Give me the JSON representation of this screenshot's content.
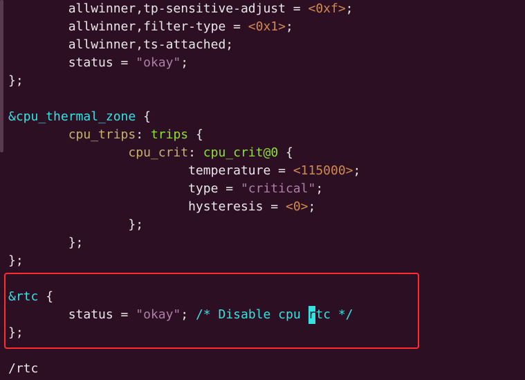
{
  "code": {
    "l01": {
      "i2": "allwinner,tp-sensitive-adjust = ",
      "hex": "<0xf>",
      "tail": ";"
    },
    "l02": {
      "i2": "allwinner,filter-type = ",
      "hex": "<0x1>",
      "tail": ";"
    },
    "l03": {
      "i2": "allwinner,ts-attached;"
    },
    "l04": {
      "i2": "status = ",
      "str": "\"okay\"",
      "tail": ";"
    },
    "l05": {
      "close": "};"
    },
    "l06": "",
    "l07": {
      "ref": "&cpu_thermal_zone",
      "open": " {"
    },
    "l08": {
      "label": "cpu_trips",
      "colon": ": ",
      "node": "trips",
      "open": " {"
    },
    "l09": {
      "label": "cpu_crit",
      "colon": ": ",
      "node": "cpu_crit@0",
      "open": " {"
    },
    "l10": {
      "key": "temperature = ",
      "hex": "<115000>",
      "tail": ";"
    },
    "l11": {
      "key": "type = ",
      "str": "\"critical\"",
      "tail": ";"
    },
    "l12": {
      "key": "hysteresis = ",
      "hex": "<0>",
      "tail": ";"
    },
    "l13": {
      "close": "};"
    },
    "l14": {
      "close": "};"
    },
    "l15": {
      "close": "};"
    },
    "l16": "",
    "l17": {
      "ref": "&rtc",
      "open": " {"
    },
    "l18": {
      "key": "status = ",
      "str": "\"okay\"",
      "mid": "; ",
      "comment_a": "/* Disable cpu ",
      "cursor": "r",
      "comment_b": "tc */"
    },
    "l19": {
      "close": "};"
    },
    "l20": "",
    "l21": {
      "search": "/rtc"
    }
  }
}
